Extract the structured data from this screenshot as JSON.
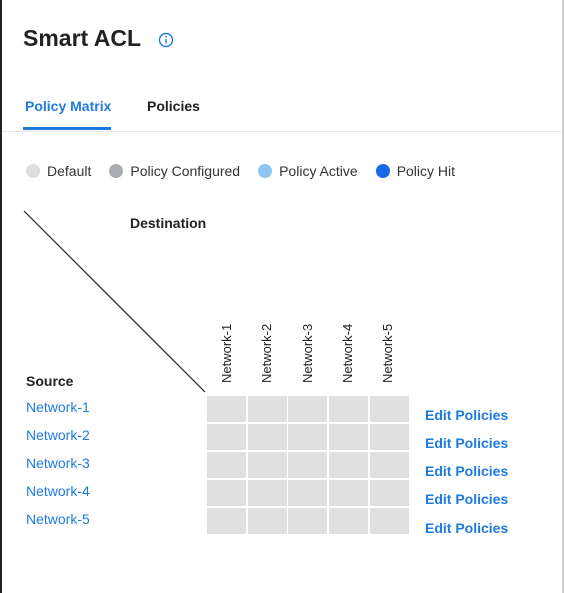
{
  "title": "Smart ACL",
  "tabs": [
    {
      "label": "Policy Matrix",
      "active": true
    },
    {
      "label": "Policies",
      "active": false
    }
  ],
  "legend": [
    {
      "label": "Default",
      "color": "#dedede"
    },
    {
      "label": "Policy Configured",
      "color": "#a9adb2"
    },
    {
      "label": "Policy Active",
      "color": "#8ec5f5"
    },
    {
      "label": "Policy Hit",
      "color": "#1669e8"
    }
  ],
  "matrix": {
    "destination_label": "Destination",
    "source_label": "Source",
    "columns": [
      "Network-1",
      "Network-2",
      "Network-3",
      "Network-4",
      "Network-5"
    ],
    "rows": [
      {
        "label": "Network-1",
        "action": "Edit Policies"
      },
      {
        "label": "Network-2",
        "action": "Edit Policies"
      },
      {
        "label": "Network-3",
        "action": "Edit Policies"
      },
      {
        "label": "Network-4",
        "action": "Edit Policies"
      },
      {
        "label": "Network-5",
        "action": "Edit Policies"
      }
    ],
    "cell_state": "Default"
  },
  "colors": {
    "accent": "#1f7ae0",
    "cell_default": "#e0e0e0"
  }
}
